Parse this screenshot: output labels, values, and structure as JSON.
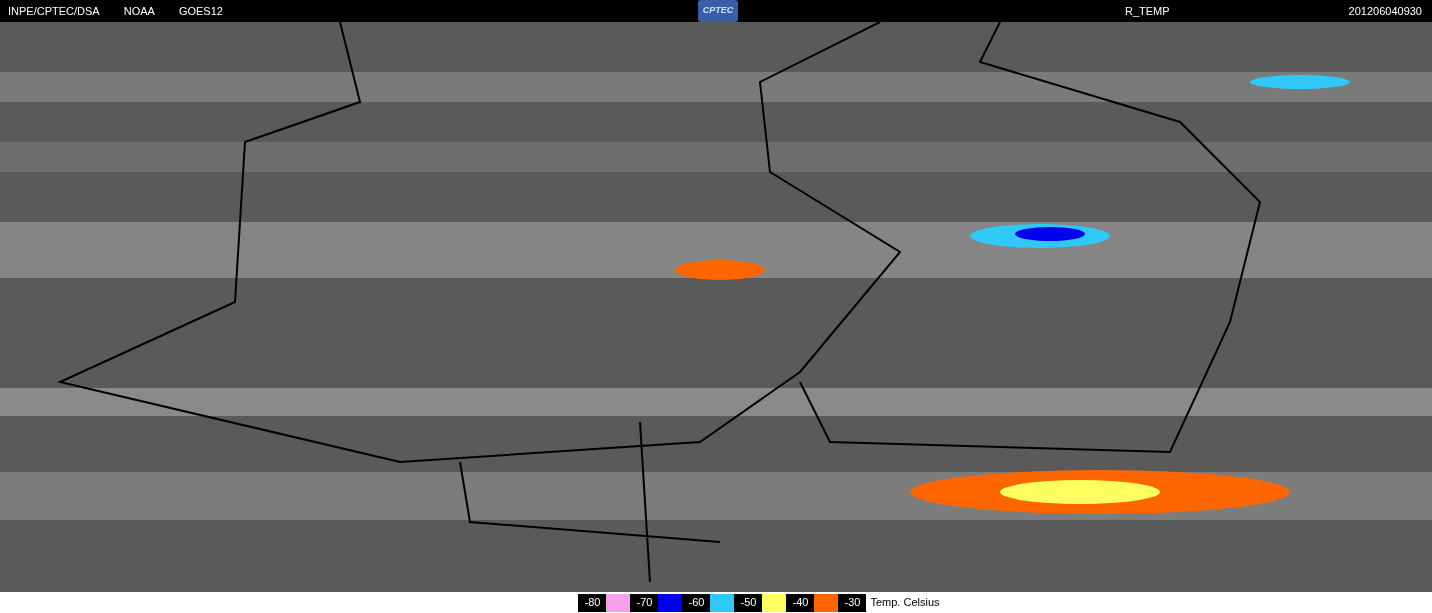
{
  "header": {
    "left": [
      "INPE/CPTEC/DSA",
      "NOAA",
      "GOES12"
    ],
    "logo": "CPTEC",
    "product": "R_TEMP",
    "timestamp": "201206040930"
  },
  "legend": {
    "items": [
      {
        "label": "-80",
        "color": "#f8a0f0"
      },
      {
        "label": "-70",
        "color": "#0000f0"
      },
      {
        "label": "-60",
        "color": "#30c8f8"
      },
      {
        "label": "-50",
        "color": "#ffff60"
      },
      {
        "label": "-40",
        "color": "#ff6600"
      }
    ],
    "last_label": "-30",
    "unit": "Temp. Celsius"
  }
}
